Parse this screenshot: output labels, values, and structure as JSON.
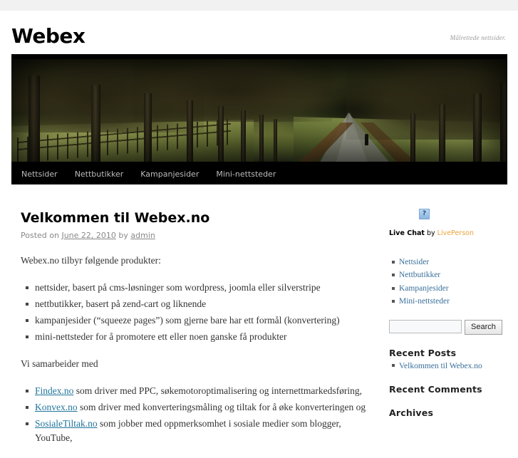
{
  "site": {
    "title": "Webex",
    "description": "Målrettede nettsider."
  },
  "nav": {
    "items": [
      {
        "label": "Nettsider"
      },
      {
        "label": "Nettbutikker"
      },
      {
        "label": "Kampanjesider"
      },
      {
        "label": "Mini-nettsteder"
      }
    ]
  },
  "post": {
    "title": "Velkommen til Webex.no",
    "meta_prefix": "Posted on",
    "date": "June 22, 2010",
    "meta_by": "by",
    "author": "admin",
    "intro": "Webex.no tilbyr følgende produkter:",
    "products": [
      "nettsider, basert på cms-løsninger som wordpress, joomla eller silverstripe",
      "nettbutikker, basert på zend-cart og liknende",
      "kampanjesider (“squeeze pages”) som gjerne bare har ett formål (konvertering)",
      "mini-nettsteder for å promotere ett eller noen ganske få produkter"
    ],
    "partners_intro": "Vi samarbeider med",
    "partners": [
      {
        "link": "Findex.no",
        "text": " som driver med PPC, søkemotoroptimalisering og internettmarkedsføring,"
      },
      {
        "link": "Konvex.no",
        "text": " som driver med konverteringsmåling og tiltak for å øke konverteringen og"
      },
      {
        "link": "SosialeTiltak.no",
        "text": " som jobber med oppmerksomhet i sosiale medier som blogger, YouTube,"
      }
    ]
  },
  "sidebar": {
    "livechat": {
      "icon": "broken-image-icon",
      "label": "Live Chat",
      "by": " by ",
      "brand": "LivePerson"
    },
    "links": [
      {
        "label": "Nettsider"
      },
      {
        "label": "Nettbutikker"
      },
      {
        "label": "Kampanjesider"
      },
      {
        "label": "Mini-nettsteder"
      }
    ],
    "search": {
      "value": "",
      "placeholder": "",
      "button_label": "Search"
    },
    "recent_posts": {
      "title": "Recent Posts",
      "items": [
        {
          "label": "Velkommen til Webex.no"
        }
      ]
    },
    "recent_comments": {
      "title": "Recent Comments"
    },
    "archives": {
      "title": "Archives"
    }
  },
  "colors": {
    "link": "#21759b",
    "sidebar_link": "#3a6f9a",
    "brand_orange": "#e8a33d",
    "nav_bg": "#000000",
    "meta_text": "#888888"
  }
}
